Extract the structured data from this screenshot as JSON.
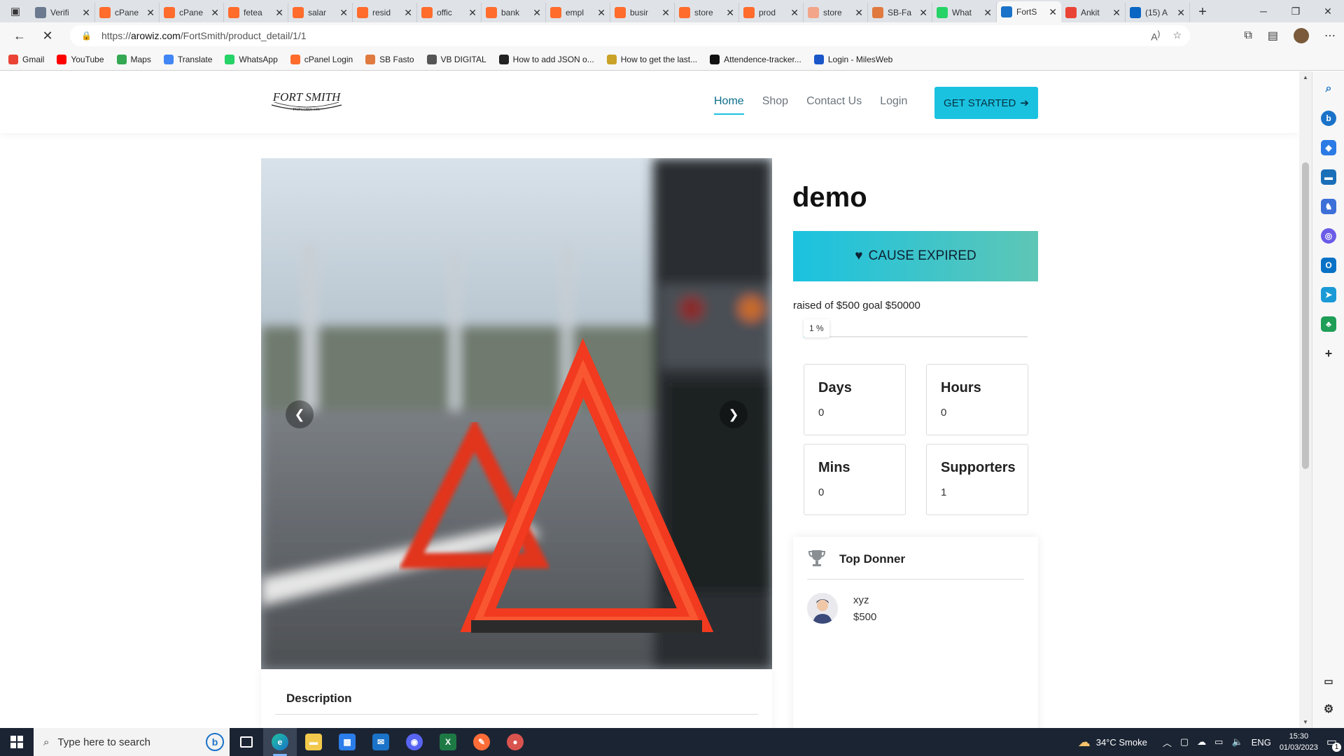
{
  "browser": {
    "tabs": [
      {
        "title": "Verifi",
        "icon": "page-icon",
        "color": "#6b7a8f"
      },
      {
        "title": "cPane",
        "icon": "cpanel-icon",
        "color": "#ff6c2c"
      },
      {
        "title": "cPane",
        "icon": "cpanel-icon",
        "color": "#ff6c2c"
      },
      {
        "title": "fetea",
        "icon": "cpanel-icon",
        "color": "#ff6c2c"
      },
      {
        "title": "salar",
        "icon": "cpanel-icon",
        "color": "#ff6c2c"
      },
      {
        "title": "resid",
        "icon": "cpanel-icon",
        "color": "#ff6c2c"
      },
      {
        "title": "offic",
        "icon": "cpanel-icon",
        "color": "#ff6c2c"
      },
      {
        "title": "bank",
        "icon": "cpanel-icon",
        "color": "#ff6c2c"
      },
      {
        "title": "empl",
        "icon": "cpanel-icon",
        "color": "#ff6c2c"
      },
      {
        "title": "busir",
        "icon": "cpanel-icon",
        "color": "#ff6c2c"
      },
      {
        "title": "store",
        "icon": "cpanel-icon",
        "color": "#ff6c2c"
      },
      {
        "title": "prod",
        "icon": "cpanel-icon",
        "color": "#ff6c2c"
      },
      {
        "title": "store",
        "icon": "cpanel-icon",
        "color": "#f3a58a"
      },
      {
        "title": "SB-Fa",
        "icon": "sb-icon",
        "color": "#e07a3f"
      },
      {
        "title": "What",
        "icon": "whatsapp-icon",
        "color": "#25d366"
      },
      {
        "title": "FortS",
        "icon": "loading-icon",
        "color": "#1a73c8",
        "active": true
      },
      {
        "title": "Ankit",
        "icon": "gmail-icon",
        "color": "#ea4335"
      },
      {
        "title": "(15) A",
        "icon": "linkedin-icon",
        "color": "#0a66c2"
      }
    ],
    "url_prefix": "https://",
    "url_host": "arowiz.com",
    "url_path": "/FortSmith/product_detail/1/1",
    "bookmarks": [
      {
        "label": "Gmail",
        "icon": "gmail-icon",
        "color": "#ea4335"
      },
      {
        "label": "YouTube",
        "icon": "youtube-icon",
        "color": "#ff0000"
      },
      {
        "label": "Maps",
        "icon": "maps-icon",
        "color": "#34a853"
      },
      {
        "label": "Translate",
        "icon": "translate-icon",
        "color": "#4285f4"
      },
      {
        "label": "WhatsApp",
        "icon": "whatsapp-icon",
        "color": "#25d366"
      },
      {
        "label": "cPanel Login",
        "icon": "cpanel-icon",
        "color": "#ff6c2c"
      },
      {
        "label": "SB Fasto",
        "icon": "sb-icon",
        "color": "#e07a3f"
      },
      {
        "label": "VB DIGITAL",
        "icon": "vb-icon",
        "color": "#555555"
      },
      {
        "label": "How to add JSON o...",
        "icon": "eh-icon",
        "color": "#222222"
      },
      {
        "label": "How to get the last...",
        "icon": "stack-icon",
        "color": "#c9a227"
      },
      {
        "label": "Attendence-tracker...",
        "icon": "github-icon",
        "color": "#111111"
      },
      {
        "label": "Login - MilesWeb",
        "icon": "milesweb-icon",
        "color": "#1a56c8"
      }
    ]
  },
  "site": {
    "logo_top": "FORT SMITH",
    "logo_bottom": "POPCORN CO.",
    "nav": [
      {
        "label": "Home",
        "active": true
      },
      {
        "label": "Shop"
      },
      {
        "label": "Contact Us"
      },
      {
        "label": "Login"
      }
    ],
    "cta": "GET STARTED",
    "accent": "#1ac2e0"
  },
  "product": {
    "title": "demo",
    "cause_button": "CAUSE EXPIRED",
    "raised_text": "raised of $500 goal $50000",
    "progress_percent": 1,
    "progress_label": "1 %",
    "stats": [
      {
        "label": "Days",
        "value": "0"
      },
      {
        "label": "Hours",
        "value": "0"
      },
      {
        "label": "Mins",
        "value": "0"
      },
      {
        "label": "Supporters",
        "value": "1"
      }
    ],
    "description_heading": "Description",
    "top_donor_heading": "Top Donner",
    "top_donor": {
      "name": "xyz",
      "amount": "$500"
    }
  },
  "taskbar": {
    "search_placeholder": "Type here to search",
    "weather": "34°C  Smoke",
    "language": "ENG",
    "time": "15:30",
    "date": "01/03/2023",
    "notification_count": "1"
  }
}
